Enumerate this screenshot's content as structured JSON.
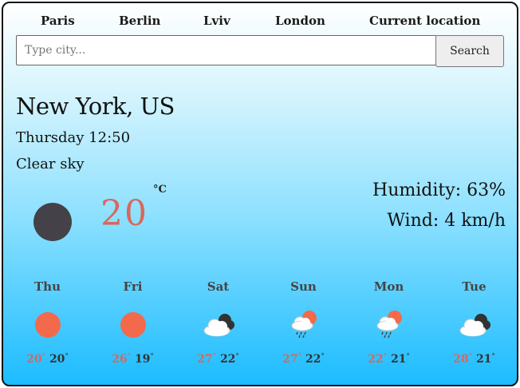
{
  "nav": {
    "cities": [
      "Paris",
      "Berlin",
      "Lviv",
      "London",
      "Current location"
    ]
  },
  "search": {
    "placeholder": "Type city...",
    "button_label": "Search"
  },
  "current": {
    "city": "New York, US",
    "datetime": "Thursday 12:50",
    "description": "Clear sky",
    "temperature": "20",
    "unit": "°C",
    "icon": "clear-night-icon",
    "humidity_label": "Humidity: 63%",
    "wind_label": "Wind: 4 km/h"
  },
  "forecast": [
    {
      "day": "Thu",
      "max": "20",
      "min": "20",
      "icon": "sun-icon"
    },
    {
      "day": "Fri",
      "max": "26",
      "min": "19",
      "icon": "sun-icon"
    },
    {
      "day": "Sat",
      "max": "27",
      "min": "22",
      "icon": "cloudy-icon"
    },
    {
      "day": "Sun",
      "max": "27",
      "min": "22",
      "icon": "sun-rain-icon"
    },
    {
      "day": "Mon",
      "max": "22",
      "min": "21",
      "icon": "sun-rain-icon"
    },
    {
      "day": "Tue",
      "max": "28",
      "min": "21",
      "icon": "cloudy-icon"
    }
  ],
  "colors": {
    "accent_temp": "#d9675c",
    "sun": "#f26a4b",
    "moon": "#444148",
    "gradient_bottom": "#1cbcff"
  }
}
